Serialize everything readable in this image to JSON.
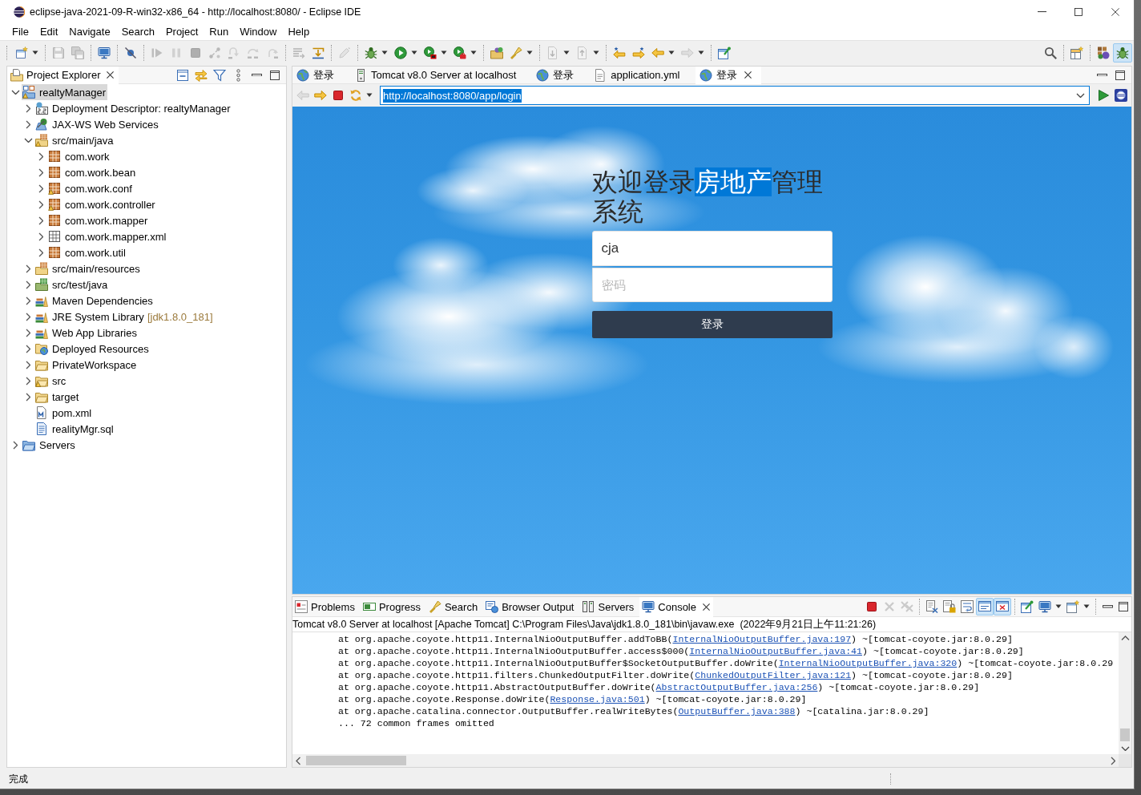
{
  "window": {
    "title": "eclipse-java-2021-09-R-win32-x86_64 - http://localhost:8080/ - Eclipse IDE"
  },
  "menu": [
    "File",
    "Edit",
    "Navigate",
    "Search",
    "Project",
    "Run",
    "Window",
    "Help"
  ],
  "toolbar": {
    "left": [
      [
        {
          "kind": "new",
          "dropdown": true,
          "disabled": false
        }
      ],
      [
        {
          "kind": "save",
          "dropdown": false,
          "disabled": true
        },
        {
          "kind": "save-all",
          "dropdown": false,
          "disabled": true
        }
      ],
      [
        {
          "kind": "console",
          "dropdown": false,
          "disabled": false
        }
      ],
      [
        {
          "kind": "skip",
          "dropdown": false,
          "disabled": false
        }
      ],
      [
        {
          "kind": "resume",
          "dropdown": false,
          "disabled": true
        },
        {
          "kind": "suspend",
          "dropdown": false,
          "disabled": true
        },
        {
          "kind": "terminate",
          "dropdown": false,
          "disabled": true
        },
        {
          "kind": "disconnect",
          "dropdown": false,
          "disabled": true
        },
        {
          "kind": "step-into",
          "dropdown": false,
          "disabled": true
        },
        {
          "kind": "step-over",
          "dropdown": false,
          "disabled": true
        },
        {
          "kind": "step-return",
          "dropdown": false,
          "disabled": true
        }
      ],
      [
        {
          "kind": "step-filters",
          "dropdown": false,
          "disabled": true
        },
        {
          "kind": "use-filters",
          "dropdown": false,
          "disabled": false
        }
      ],
      [
        {
          "kind": "annotate",
          "dropdown": false,
          "disabled": true
        }
      ],
      [
        {
          "kind": "debug",
          "dropdown": true,
          "disabled": false
        },
        {
          "kind": "run",
          "dropdown": true,
          "disabled": false
        },
        {
          "kind": "coverage",
          "dropdown": true,
          "disabled": false
        },
        {
          "kind": "external-tools",
          "dropdown": true,
          "disabled": false
        }
      ],
      [
        {
          "kind": "open-type",
          "dropdown": false,
          "disabled": false
        },
        {
          "kind": "search",
          "dropdown": true,
          "disabled": false
        }
      ],
      [
        {
          "kind": "next-annotation",
          "dropdown": true,
          "disabled": true
        },
        {
          "kind": "prev-annotation",
          "dropdown": true,
          "disabled": true
        }
      ],
      [
        {
          "kind": "last-edit",
          "dropdown": false,
          "disabled": false
        },
        {
          "kind": "next-edit",
          "dropdown": false,
          "disabled": false
        },
        {
          "kind": "back",
          "dropdown": true,
          "disabled": false
        },
        {
          "kind": "forward",
          "dropdown": true,
          "disabled": true
        }
      ],
      [
        {
          "kind": "pin-editor",
          "dropdown": false,
          "disabled": false
        }
      ]
    ],
    "right": [
      [
        {
          "kind": "find",
          "dropdown": false,
          "disabled": false
        }
      ],
      [
        {
          "kind": "open-perspective",
          "dropdown": false,
          "disabled": false
        }
      ],
      [
        {
          "kind": "javaee",
          "dropdown": false,
          "disabled": false,
          "selected": false
        },
        {
          "kind": "debug-perspective",
          "dropdown": false,
          "disabled": false,
          "selected": true
        }
      ]
    ]
  },
  "explorer": {
    "tabs": [
      {
        "label": "Project Explorer",
        "selected": true
      }
    ],
    "tree": [
      {
        "label": "realtyManager",
        "kind": "project",
        "expanded": true,
        "selected": true,
        "warning": true,
        "children": [
          {
            "label": "Deployment Descriptor: realtyManager",
            "kind": "descriptor",
            "expanded": false,
            "selected": false,
            "warning": false
          },
          {
            "label": "JAX-WS Web Services",
            "kind": "web-services",
            "expanded": false,
            "selected": false,
            "warning": false
          },
          {
            "label": "src/main/java",
            "kind": "source-folder",
            "expanded": true,
            "selected": false,
            "warning": true,
            "children": [
              {
                "label": "com.work",
                "kind": "package",
                "expanded": false,
                "selected": false,
                "warning": false
              },
              {
                "label": "com.work.bean",
                "kind": "package",
                "expanded": false,
                "selected": false,
                "warning": false
              },
              {
                "label": "com.work.conf",
                "kind": "package",
                "expanded": false,
                "selected": false,
                "warning": true
              },
              {
                "label": "com.work.controller",
                "kind": "package",
                "expanded": false,
                "selected": false,
                "warning": true
              },
              {
                "label": "com.work.mapper",
                "kind": "package",
                "expanded": false,
                "selected": false,
                "warning": false
              },
              {
                "label": "com.work.mapper.xml",
                "kind": "resource-package",
                "expanded": false,
                "selected": false,
                "warning": false
              },
              {
                "label": "com.work.util",
                "kind": "package",
                "expanded": false,
                "selected": false,
                "warning": false
              }
            ]
          },
          {
            "label": "src/main/resources",
            "kind": "source-folder",
            "expanded": false,
            "selected": false,
            "warning": false
          },
          {
            "label": "src/test/java",
            "kind": "test-folder",
            "expanded": false,
            "selected": false,
            "warning": false
          },
          {
            "label": "Maven Dependencies",
            "kind": "library",
            "expanded": false,
            "selected": false,
            "warning": false
          },
          {
            "label": "JRE System Library",
            "decoration": "[jdk1.8.0_181]",
            "kind": "library",
            "expanded": false,
            "selected": false,
            "warning": false
          },
          {
            "label": "Web App Libraries",
            "kind": "library",
            "expanded": false,
            "selected": false,
            "warning": false
          },
          {
            "label": "Deployed Resources",
            "kind": "deployed",
            "expanded": false,
            "selected": false,
            "warning": false
          },
          {
            "label": "PrivateWorkspace",
            "kind": "folder",
            "expanded": false,
            "selected": false,
            "warning": false
          },
          {
            "label": "src",
            "kind": "folder",
            "expanded": false,
            "selected": false,
            "warning": true
          },
          {
            "label": "target",
            "kind": "folder",
            "expanded": false,
            "selected": false,
            "warning": false
          },
          {
            "label": "pom.xml",
            "kind": "maven-file",
            "selected": false,
            "warning": false
          },
          {
            "label": "realityMgr.sql",
            "kind": "sql-file",
            "selected": false,
            "warning": false
          }
        ]
      },
      {
        "label": "Servers",
        "kind": "servers-folder",
        "expanded": false,
        "selected": false,
        "warning": false
      }
    ]
  },
  "editor": {
    "tabs": [
      {
        "label": "登录",
        "kind": "web",
        "selected": false
      },
      {
        "label": "Tomcat v8.0 Server at localhost",
        "kind": "server",
        "selected": false
      },
      {
        "label": "登录",
        "kind": "web",
        "selected": false
      },
      {
        "label": "application.yml",
        "kind": "text-file",
        "selected": false
      },
      {
        "label": "登录",
        "kind": "web",
        "selected": true
      }
    ],
    "browser": {
      "buttons": [
        [
          {
            "kind": "back",
            "dropdown": false,
            "disabled": true
          },
          {
            "kind": "forward",
            "dropdown": false,
            "disabled": false
          },
          {
            "kind": "stop",
            "dropdown": false,
            "disabled": false
          },
          {
            "kind": "refresh",
            "dropdown": true,
            "disabled": false
          }
        ]
      ],
      "url": {
        "value": "http://localhost:8080/app/login",
        "selected": true
      }
    },
    "page": {
      "title_parts": [
        {
          "text": "欢迎登录",
          "selected": false
        },
        {
          "text": "房地产",
          "selected": true
        },
        {
          "text": "管理系统",
          "selected": false
        }
      ],
      "username": {
        "value": "cja"
      },
      "password": {
        "placeholder": "密码"
      },
      "submit": "登录"
    }
  },
  "console": {
    "tabs": [
      {
        "label": "Problems",
        "kind": "problems",
        "selected": false
      },
      {
        "label": "Progress",
        "kind": "progress",
        "selected": false
      },
      {
        "label": "Search",
        "kind": "search",
        "selected": false
      },
      {
        "label": "Browser Output",
        "kind": "browser-output",
        "selected": false
      },
      {
        "label": "Servers",
        "kind": "servers",
        "selected": false
      },
      {
        "label": "Console",
        "kind": "console",
        "selected": true
      }
    ],
    "toolbar": [
      [
        {
          "kind": "terminate",
          "dropdown": false,
          "disabled": false
        },
        {
          "kind": "remove",
          "dropdown": false,
          "disabled": true
        },
        {
          "kind": "remove-all",
          "dropdown": false,
          "disabled": true
        }
      ],
      [
        {
          "kind": "clear",
          "dropdown": false,
          "disabled": false,
          "selected": false
        },
        {
          "kind": "scroll-lock",
          "dropdown": false,
          "disabled": false,
          "selected": false
        },
        {
          "kind": "word-wrap",
          "dropdown": false,
          "disabled": false,
          "selected": false
        },
        {
          "kind": "stdout",
          "dropdown": false,
          "disabled": false,
          "selected": true
        },
        {
          "kind": "stderr",
          "dropdown": false,
          "disabled": false,
          "selected": true
        }
      ],
      [
        {
          "kind": "pin",
          "dropdown": false,
          "disabled": false
        },
        {
          "kind": "display",
          "dropdown": true,
          "disabled": false
        },
        {
          "kind": "open-console",
          "dropdown": true,
          "disabled": false
        }
      ]
    ],
    "process": "Tomcat v8.0 Server at localhost [Apache Tomcat] C:\\Program Files\\Java\\jdk1.8.0_181\\bin\\javaw.exe  (2022年9月21日上午11:21:26)",
    "lines": [
      {
        "text": "at org.apache.coyote.http11.InternalNioOutputBuffer.addToBB(",
        "link": "InternalNioOutputBuffer.java:197",
        "rest": ") ~[tomcat-coyote.jar:8.0.29]"
      },
      {
        "text": "at org.apache.coyote.http11.InternalNioOutputBuffer.access$000(",
        "link": "InternalNioOutputBuffer.java:41",
        "rest": ") ~[tomcat-coyote.jar:8.0.29]"
      },
      {
        "text": "at org.apache.coyote.http11.InternalNioOutputBuffer$SocketOutputBuffer.doWrite(",
        "link": "InternalNioOutputBuffer.java:320",
        "rest": ") ~[tomcat-coyote.jar:8.0.29"
      },
      {
        "text": "at org.apache.coyote.http11.filters.ChunkedOutputFilter.doWrite(",
        "link": "ChunkedOutputFilter.java:121",
        "rest": ") ~[tomcat-coyote.jar:8.0.29]"
      },
      {
        "text": "at org.apache.coyote.http11.AbstractOutputBuffer.doWrite(",
        "link": "AbstractOutputBuffer.java:256",
        "rest": ") ~[tomcat-coyote.jar:8.0.29]"
      },
      {
        "text": "at org.apache.coyote.Response.doWrite(",
        "link": "Response.java:501",
        "rest": ") ~[tomcat-coyote.jar:8.0.29]"
      },
      {
        "text": "at org.apache.catalina.connector.OutputBuffer.realWriteBytes(",
        "link": "OutputBuffer.java:388",
        "rest": ") ~[catalina.jar:8.0.29]"
      },
      {
        "text": "... 72 common frames omitted"
      }
    ]
  },
  "status_bar": {
    "message": "完成"
  }
}
